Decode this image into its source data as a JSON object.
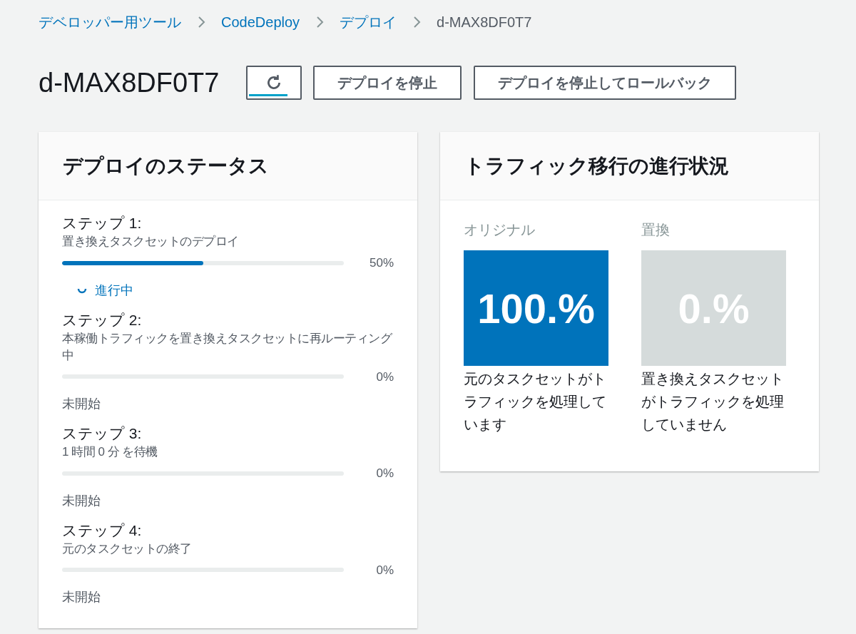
{
  "breadcrumbs": [
    {
      "label": "デベロッパー用ツール",
      "kind": "link"
    },
    {
      "label": "CodeDeploy",
      "kind": "link"
    },
    {
      "label": "デプロイ",
      "kind": "link"
    },
    {
      "label": "d-MAX8DF0T7",
      "kind": "current"
    }
  ],
  "title": "d-MAX8DF0T7",
  "refresh_button": {
    "focused": true
  },
  "buttons": [
    "デプロイを停止",
    "デプロイを停止してロールバック"
  ],
  "status_panel": {
    "title": "デプロイのステータス",
    "steps": [
      {
        "label": "ステップ 1:",
        "description": "置き換えタスクセットのデプロイ",
        "level": 0.5,
        "percent": "50%",
        "status": "進行中",
        "kind": "in_progress"
      },
      {
        "label": "ステップ 2:",
        "description": "本稼働トラフィックを置き換えタスクセットに再ルーティング中",
        "level": 0,
        "percent": "0%",
        "status": "未開始",
        "kind": "not_started"
      },
      {
        "label": "ステップ 3:",
        "description": "1 時間 0 分 を待機",
        "level": 0,
        "percent": "0%",
        "status": "未開始",
        "kind": "not_started"
      },
      {
        "label": "ステップ 4:",
        "description": "元のタスクセットの終了",
        "level": 0,
        "percent": "0%",
        "status": "未開始",
        "kind": "not_started"
      }
    ]
  },
  "traffic_panel": {
    "title": "トラフィック移行の進行状況",
    "columns": [
      {
        "label": "オリジナル",
        "value": "100.%",
        "description": "元のタスクセットがトラフィックを処理しています",
        "kind": "original"
      },
      {
        "label": "置換",
        "value": "0.%",
        "description": "置き換えタスクセットがトラフィックを処理していません",
        "kind": "replacement"
      }
    ]
  }
}
